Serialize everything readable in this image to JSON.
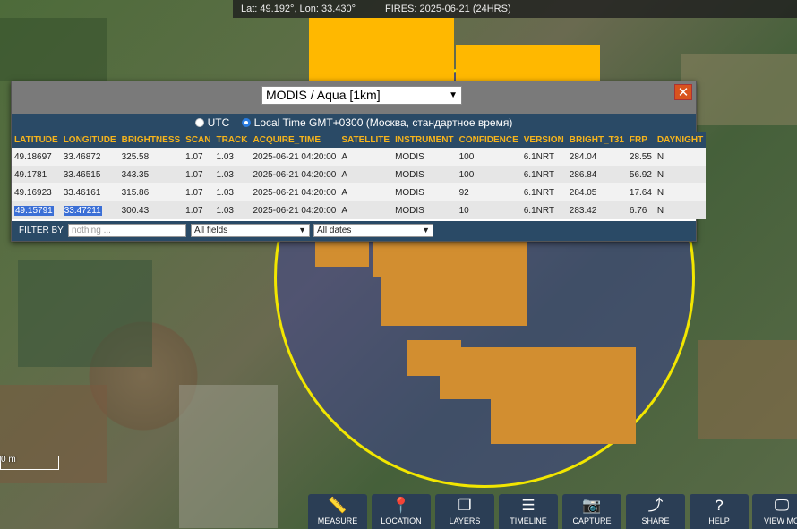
{
  "topbar": {
    "coords": "Lat: 49.192°, Lon: 33.430°",
    "fires": "FIRES: 2025-06-21 (24HRS)"
  },
  "panel": {
    "dataset": "MODIS / Aqua [1km]",
    "close": "✕",
    "tz_utc": "UTC",
    "tz_local": "Local Time GMT+0300 (Москва, стандартное время)",
    "columns": [
      "LATITUDE",
      "LONGITUDE",
      "BRIGHTNESS",
      "SCAN",
      "TRACK",
      "ACQUIRE_TIME",
      "SATELLITE",
      "INSTRUMENT",
      "CONFIDENCE",
      "VERSION",
      "BRIGHT_T31",
      "FRP",
      "DAYNIGHT"
    ],
    "rows": [
      [
        "49.18697",
        "33.46872",
        "325.58",
        "1.07",
        "1.03",
        "2025-06-21 04:20:00",
        "A",
        "MODIS",
        "100",
        "6.1NRT",
        "284.04",
        "28.55",
        "N"
      ],
      [
        "49.1781",
        "33.46515",
        "343.35",
        "1.07",
        "1.03",
        "2025-06-21 04:20:00",
        "A",
        "MODIS",
        "100",
        "6.1NRT",
        "286.84",
        "56.92",
        "N"
      ],
      [
        "49.16923",
        "33.46161",
        "315.86",
        "1.07",
        "1.03",
        "2025-06-21 04:20:00",
        "A",
        "MODIS",
        "92",
        "6.1NRT",
        "284.05",
        "17.64",
        "N"
      ],
      [
        "49.15791",
        "33.47211",
        "300.43",
        "1.07",
        "1.03",
        "2025-06-21 04:20:00",
        "A",
        "MODIS",
        "10",
        "6.1NRT",
        "283.42",
        "6.76",
        "N"
      ]
    ],
    "filter_label": "FILTER BY",
    "filter_placeholder": "nothing ...",
    "field_select": "All fields",
    "date_select": "All dates"
  },
  "scale": {
    "label": "0 m"
  },
  "toolbar": [
    {
      "label": "MEASURE",
      "icon": "ruler-icon",
      "glyph": "📏"
    },
    {
      "label": "LOCATION",
      "icon": "pin-icon",
      "glyph": "📍"
    },
    {
      "label": "LAYERS",
      "icon": "layers-icon",
      "glyph": "❐"
    },
    {
      "label": "TIMELINE",
      "icon": "sliders-icon",
      "glyph": "☰"
    },
    {
      "label": "CAPTURE",
      "icon": "camera-icon",
      "glyph": "📷"
    },
    {
      "label": "SHARE",
      "icon": "share-icon",
      "glyph": "⤴"
    },
    {
      "label": "HELP",
      "icon": "help-icon",
      "glyph": "?"
    },
    {
      "label": "VIEW MO",
      "icon": "monitor-icon",
      "glyph": "🖵"
    }
  ],
  "colors": {
    "fire_yellow": "#ffb800",
    "fire_orange": "#d28e30",
    "circle": "#f2e600",
    "header_bg": "#2a4a66"
  }
}
